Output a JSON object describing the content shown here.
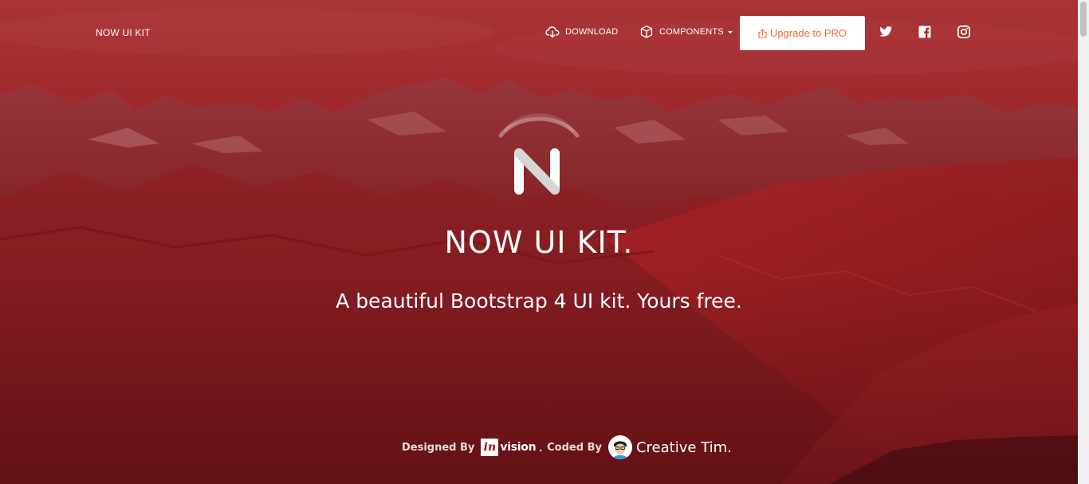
{
  "navbar": {
    "brand": "NOW UI KIT",
    "items": [
      {
        "label": "DOWNLOAD",
        "icon": "cloud-download-icon"
      },
      {
        "label": "COMPONENTS",
        "icon": "box-icon"
      }
    ],
    "upgrade_label": "Upgrade to PRO",
    "social": [
      "twitter-icon",
      "facebook-icon",
      "instagram-icon"
    ]
  },
  "hero": {
    "title": "NOW UI KIT.",
    "subtitle": "A beautiful Bootstrap 4 UI kit. Yours free."
  },
  "credits": {
    "designed_by": "Designed By",
    "invision_mark": "in",
    "invision_text": "vision",
    "dot": ".",
    "coded_by": "Coded By",
    "creative_tim": "Creative Tim",
    "ct_dot": "."
  },
  "colors": {
    "overlay": "#8a1a1c",
    "accent": "#f96332",
    "text": "#ffffff"
  }
}
